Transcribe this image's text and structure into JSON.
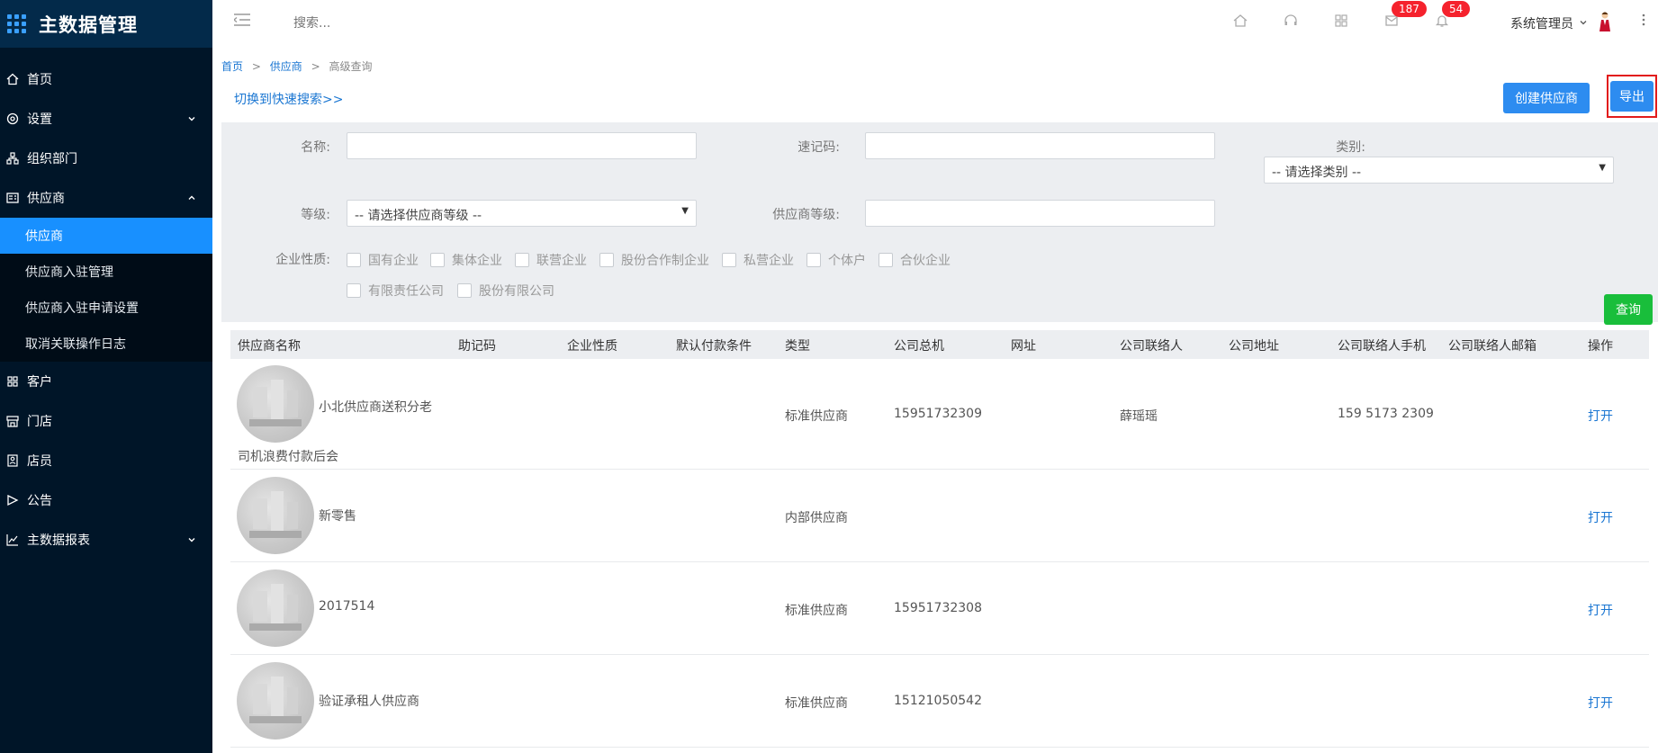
{
  "app": {
    "title": "主数据管理"
  },
  "sidebar": {
    "items": [
      {
        "label": "首页",
        "icon": "home-icon"
      },
      {
        "label": "设置",
        "icon": "gear-icon",
        "has_children": true,
        "expanded": false
      },
      {
        "label": "组织部门",
        "icon": "org-icon"
      },
      {
        "label": "供应商",
        "icon": "vendor-card-icon",
        "has_children": true,
        "expanded": true
      },
      {
        "label": "客户",
        "icon": "customer-icon"
      },
      {
        "label": "门店",
        "icon": "store-icon"
      },
      {
        "label": "店员",
        "icon": "staff-icon"
      },
      {
        "label": "公告",
        "icon": "announcement-icon"
      },
      {
        "label": "主数据报表",
        "icon": "report-chart-icon",
        "has_children": true,
        "expanded": false
      }
    ],
    "supplier_sub": [
      {
        "label": "供应商",
        "active": true
      },
      {
        "label": "供应商入驻管理"
      },
      {
        "label": "供应商入驻申请设置"
      },
      {
        "label": "取消关联操作日志"
      }
    ]
  },
  "header": {
    "search_placeholder": "搜索...",
    "message_count": "187",
    "notification_count": "54",
    "user_name": "系统管理员"
  },
  "breadcrumb": {
    "home": "首页",
    "sep": ">",
    "supplier": "供应商",
    "current": "高级查询"
  },
  "actions": {
    "switch_link": "切换到快速搜索>>",
    "create": "创建供应商",
    "export": "导出",
    "query": "查询"
  },
  "filters": {
    "name_label": "名称:",
    "code_label": "速记码:",
    "category_label": "类别:",
    "category_value": "-- 请选择类别 --",
    "grade_label": "等级:",
    "grade_value": "-- 请选择供应商等级 --",
    "supplier_grade_label": "供应商等级:",
    "nature_label": "企业性质:",
    "natures": [
      "国有企业",
      "集体企业",
      "联营企业",
      "股份合作制企业",
      "私营企业",
      "个体户",
      "合伙企业",
      "有限责任公司",
      "股份有限公司"
    ]
  },
  "table": {
    "columns": [
      "供应商名称",
      "助记码",
      "企业性质",
      "默认付款条件",
      "类型",
      "公司总机",
      "网址",
      "公司联络人",
      "公司地址",
      "公司联络人手机",
      "公司联络人邮箱",
      "操作"
    ],
    "rows": [
      {
        "name_line1": "小北供应商送积分老",
        "name_line2": "司机浪费付款后会",
        "type": "标准供应商",
        "phone": "15951732309",
        "contact": "薛瑶瑶",
        "mobile": "159 5173 2309",
        "action": "打开"
      },
      {
        "name_line1": "新零售",
        "name_line2": "",
        "type": "内部供应商",
        "phone": "",
        "contact": "",
        "mobile": "",
        "action": "打开"
      },
      {
        "name_line1": "2017514",
        "name_line2": "",
        "type": "标准供应商",
        "phone": "15951732308",
        "contact": "",
        "mobile": "",
        "action": "打开"
      },
      {
        "name_line1": "验证承租人供应商",
        "name_line2": "",
        "type": "标准供应商",
        "phone": "15121050542",
        "contact": "",
        "mobile": "",
        "action": "打开"
      }
    ]
  },
  "colors": {
    "sidebar_bg": "#001528",
    "active": "#1890ff",
    "primary": "#2d8cf0",
    "success": "#19be3b",
    "badge": "#f5222d",
    "highlight": "#e21b1b"
  }
}
